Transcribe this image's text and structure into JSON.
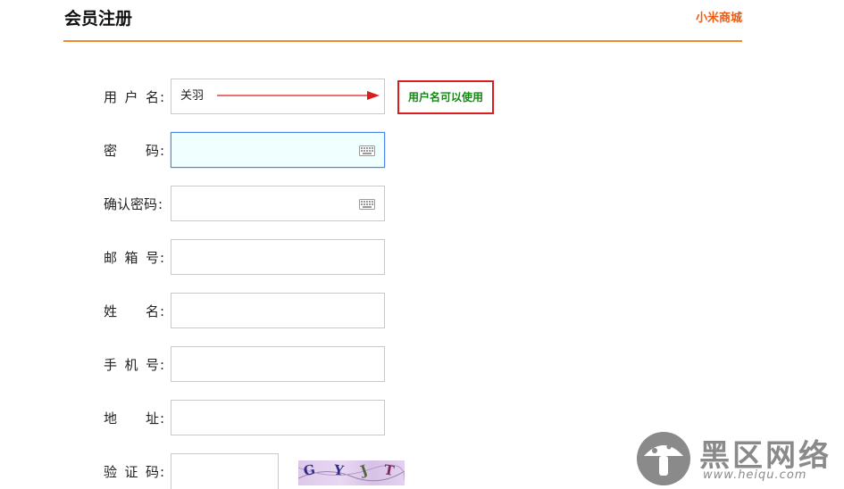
{
  "header": {
    "title": "会员注册",
    "store_link": "小米商城"
  },
  "form": {
    "username": {
      "label_chars": [
        "用",
        "户",
        "名"
      ],
      "value": "关羽"
    },
    "password": {
      "label_chars": [
        "密",
        "码"
      ],
      "value": ""
    },
    "confirm_password": {
      "label": "确认密码",
      "value": ""
    },
    "email": {
      "label_chars": [
        "邮",
        "箱",
        "号"
      ],
      "value": ""
    },
    "name": {
      "label_chars": [
        "姓",
        "名"
      ],
      "value": ""
    },
    "phone": {
      "label_chars": [
        "手",
        "机",
        "号"
      ],
      "value": ""
    },
    "address": {
      "label_chars": [
        "地",
        "址"
      ],
      "value": ""
    },
    "captcha": {
      "label_chars": [
        "验",
        "证",
        "码"
      ],
      "value": "",
      "image_text": [
        "G",
        "Y",
        "J",
        "T"
      ]
    },
    "colon": ":"
  },
  "hint": {
    "text": "用户名可以使用",
    "border_color": "#d81e1e",
    "text_color": "#108a10"
  },
  "watermark": {
    "title": "黑区网络",
    "url": "www.heiqu.com"
  },
  "colors": {
    "accent": "#f08a2a",
    "store_link": "#ee5a10",
    "focus_border": "#4a86e8"
  }
}
